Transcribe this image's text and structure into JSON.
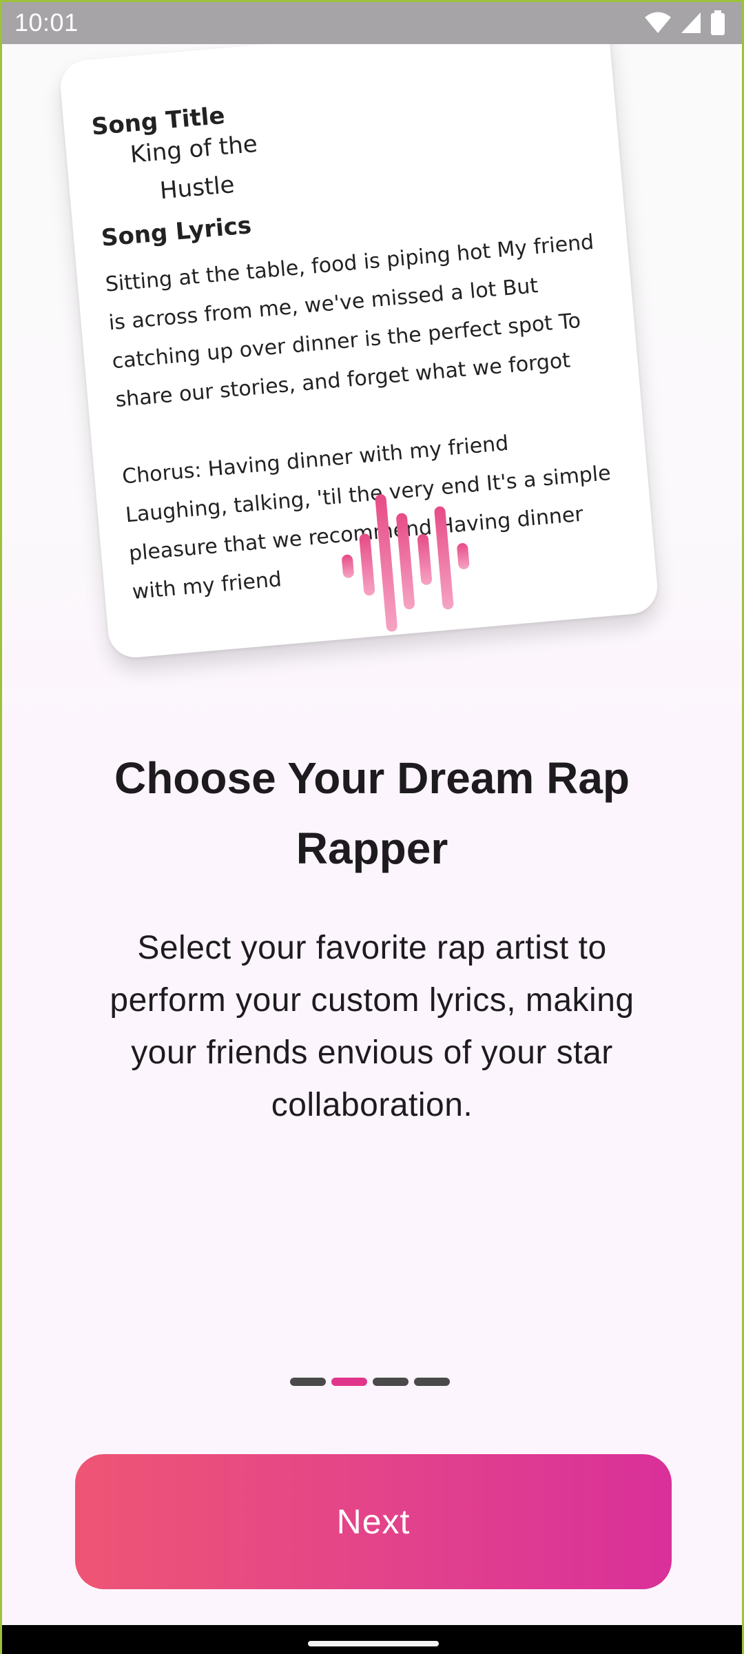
{
  "status_bar": {
    "time": "10:01"
  },
  "card": {
    "song_title_label": "Song Title",
    "song_title": "King of the Hustle",
    "lyrics_label": "Song Lyrics",
    "lyrics": "Sitting at the table, food is piping hot My friend is across from me, we've missed a lot But catching up over dinner is the perfect spot To share our stories, and forget what we forgot\n\nChorus: Having dinner with my friend Laughing, talking, 'til the very end It's a simple pleasure that we recommend Having dinner with my friend"
  },
  "onboarding": {
    "title": "Choose Your Dream Rap Rapper",
    "description": "Select your favorite rap artist to perform your custom lyrics, making your friends envious of your star collaboration.",
    "page_count": 4,
    "current_page": 2
  },
  "next_button": {
    "label": "Next"
  },
  "colors": {
    "accent_start": "#ee5574",
    "accent_end": "#d9309a",
    "indicator_active": "#e0358a",
    "indicator_inactive": "#4a4a4a",
    "background": "#fcf5fd"
  },
  "icons": [
    "wifi-icon",
    "cellular-signal-icon",
    "battery-icon",
    "sound-wave-icon"
  ]
}
